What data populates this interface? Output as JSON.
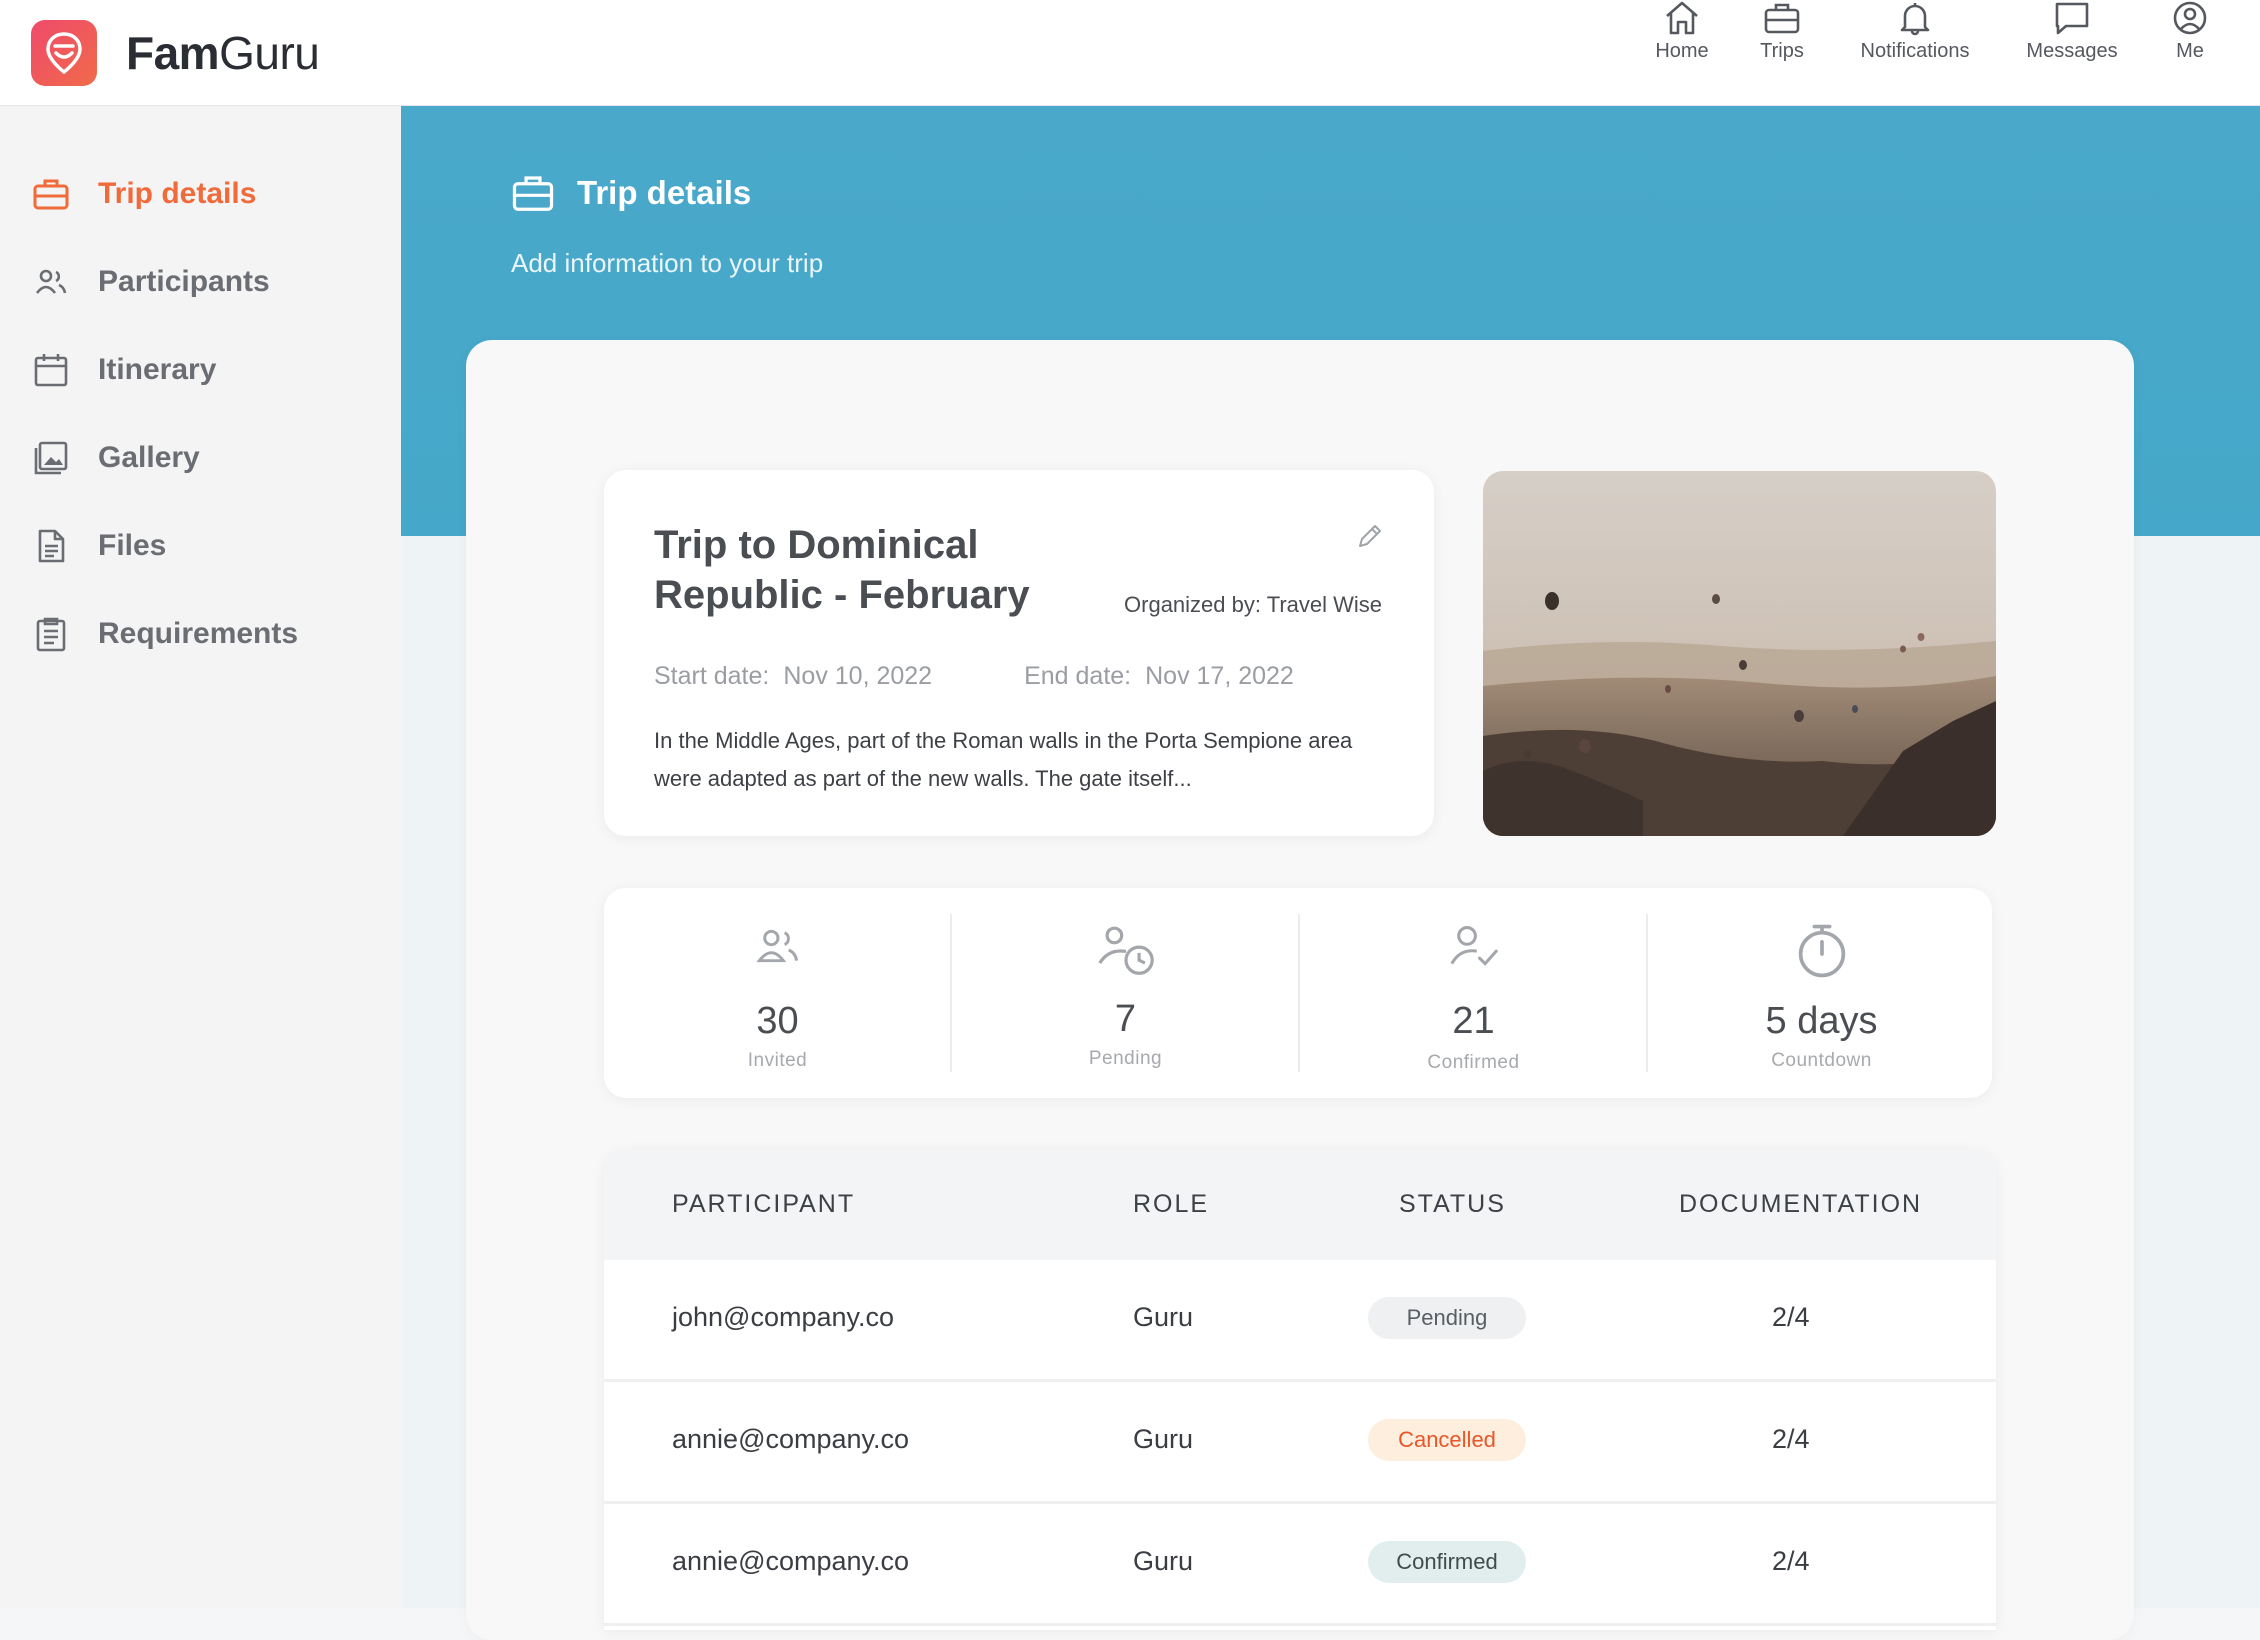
{
  "app": {
    "brand_bold": "Fam",
    "brand_light": "Guru"
  },
  "nav": {
    "items": [
      {
        "label": "Home",
        "icon": "home-icon"
      },
      {
        "label": "Trips",
        "icon": "briefcase-icon"
      },
      {
        "label": "Notifications",
        "icon": "bell-icon"
      },
      {
        "label": "Messages",
        "icon": "message-icon"
      },
      {
        "label": "Me",
        "icon": "user-circle-icon"
      }
    ]
  },
  "sidebar": {
    "items": [
      {
        "label": "Trip details",
        "icon": "briefcase-icon",
        "active": true
      },
      {
        "label": "Participants",
        "icon": "users-icon"
      },
      {
        "label": "Itinerary",
        "icon": "calendar-icon"
      },
      {
        "label": "Gallery",
        "icon": "gallery-icon"
      },
      {
        "label": "Files",
        "icon": "file-icon"
      },
      {
        "label": "Requirements",
        "icon": "clipboard-icon"
      }
    ]
  },
  "header": {
    "title": "Trip details",
    "subtitle": "Add information to your trip"
  },
  "trip": {
    "title": "Trip to Dominical Republic - February",
    "organizer": "Organized by: Travel Wise",
    "start_label": "Start date:",
    "start_value": "Nov 10, 2022",
    "end_label": "End date:",
    "end_value": "Nov 17, 2022",
    "description": "In the Middle Ages, part of the Roman walls in the Porta Sempione area were adapted as part of the new walls. The gate itself..."
  },
  "stats": [
    {
      "value": "30",
      "label": "Invited",
      "icon": "users-icon"
    },
    {
      "value": "7",
      "label": "Pending",
      "icon": "user-clock-icon"
    },
    {
      "value": "21",
      "label": "Confirmed",
      "icon": "user-check-icon"
    },
    {
      "value": "5 days",
      "label": "Countdown",
      "icon": "stopwatch-icon"
    }
  ],
  "table": {
    "headers": [
      "PARTICIPANT",
      "ROLE",
      "STATUS",
      "DOCUMENTATION"
    ],
    "rows": [
      {
        "participant": "john@company.co",
        "role": "Guru",
        "status": "Pending",
        "documentation": "2/4"
      },
      {
        "participant": "annie@company.co",
        "role": "Guru",
        "status": "Cancelled",
        "documentation": "2/4"
      },
      {
        "participant": "annie@company.co",
        "role": "Guru",
        "status": "Confirmed",
        "documentation": "2/4"
      }
    ]
  },
  "colors": {
    "accent": "#f06a3a",
    "hero": "#4aa9cb",
    "logo_start": "#ef4a6b",
    "logo_end": "#f06a4a"
  }
}
